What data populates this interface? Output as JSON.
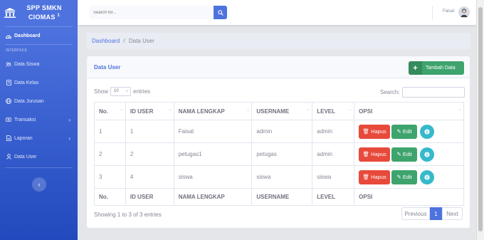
{
  "sidebar": {
    "brand_line1": "SPP SMKN",
    "brand_line2": "CIOMAS",
    "brand_sup": "1",
    "dashboard": "Dashboard",
    "heading": "INTERFACE",
    "items": [
      {
        "label": "Data Siswa",
        "icon": "users-icon"
      },
      {
        "label": "Data Kelas",
        "icon": "book-icon"
      },
      {
        "label": "Data Jurusan",
        "icon": "globe-icon"
      },
      {
        "label": "Transaksi",
        "icon": "money-icon",
        "chevron": true
      },
      {
        "label": "Laporan",
        "icon": "file-icon",
        "chevron": true
      },
      {
        "label": "Data User",
        "icon": "user-icon"
      }
    ],
    "toggle_icon": "chevron-left-icon"
  },
  "topbar": {
    "search_placeholder": "Search for...",
    "user_name": "Faisal"
  },
  "breadcrumb": {
    "home": "Dashboard",
    "sep": "/",
    "current": "Data User"
  },
  "card": {
    "title": "Data User",
    "add_button": "Tambah Data",
    "show_label": "Show",
    "entries_value": "10",
    "entries_label": "entries",
    "search_label": "Search:",
    "columns": [
      "No.",
      "ID USER",
      "NAMA LENGKAP",
      "USERNAME",
      "LEVEL",
      "OPSI"
    ],
    "rows": [
      [
        "1",
        "1",
        "Faisal",
        "admin",
        "admin"
      ],
      [
        "2",
        "2",
        "petugas1",
        "petugas",
        "admin"
      ],
      [
        "3",
        "4",
        "siswa",
        "siswa",
        "siswa"
      ]
    ],
    "delete_label": "Hapus",
    "edit_label": "Edit",
    "info_text": "Showing 1 to 3 of 3 entries",
    "pager": {
      "prev": "Previous",
      "current": "1",
      "next": "Next"
    }
  },
  "colors": {
    "primary": "#4e73df",
    "success": "#3ea46e",
    "danger": "#e74a3b",
    "info": "#36b9cc"
  }
}
